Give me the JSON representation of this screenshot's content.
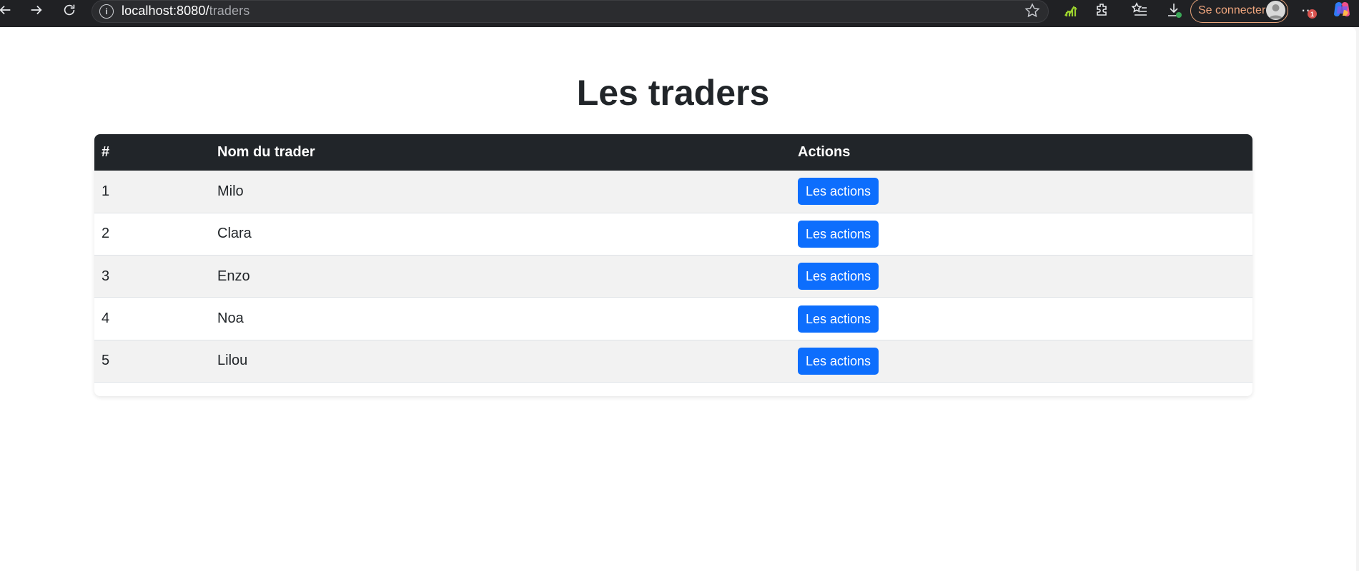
{
  "browser": {
    "url_host": "localhost:8080/",
    "url_path": "traders",
    "signin_label": "Se connecter",
    "notification_badge": "1",
    "more_label": "···"
  },
  "page": {
    "title": "Les traders"
  },
  "table": {
    "headers": [
      "#",
      "Nom du trader",
      "Actions"
    ],
    "rows": [
      {
        "id": "1",
        "name": "Milo",
        "action_label": "Les actions"
      },
      {
        "id": "2",
        "name": "Clara",
        "action_label": "Les actions"
      },
      {
        "id": "3",
        "name": "Enzo",
        "action_label": "Les actions"
      },
      {
        "id": "4",
        "name": "Noa",
        "action_label": "Les actions"
      },
      {
        "id": "5",
        "name": "Lilou",
        "action_label": "Les actions"
      }
    ]
  },
  "colors": {
    "header_bg": "#212529",
    "button_primary": "#0d6efd",
    "row_stripe": "#f2f2f2"
  }
}
